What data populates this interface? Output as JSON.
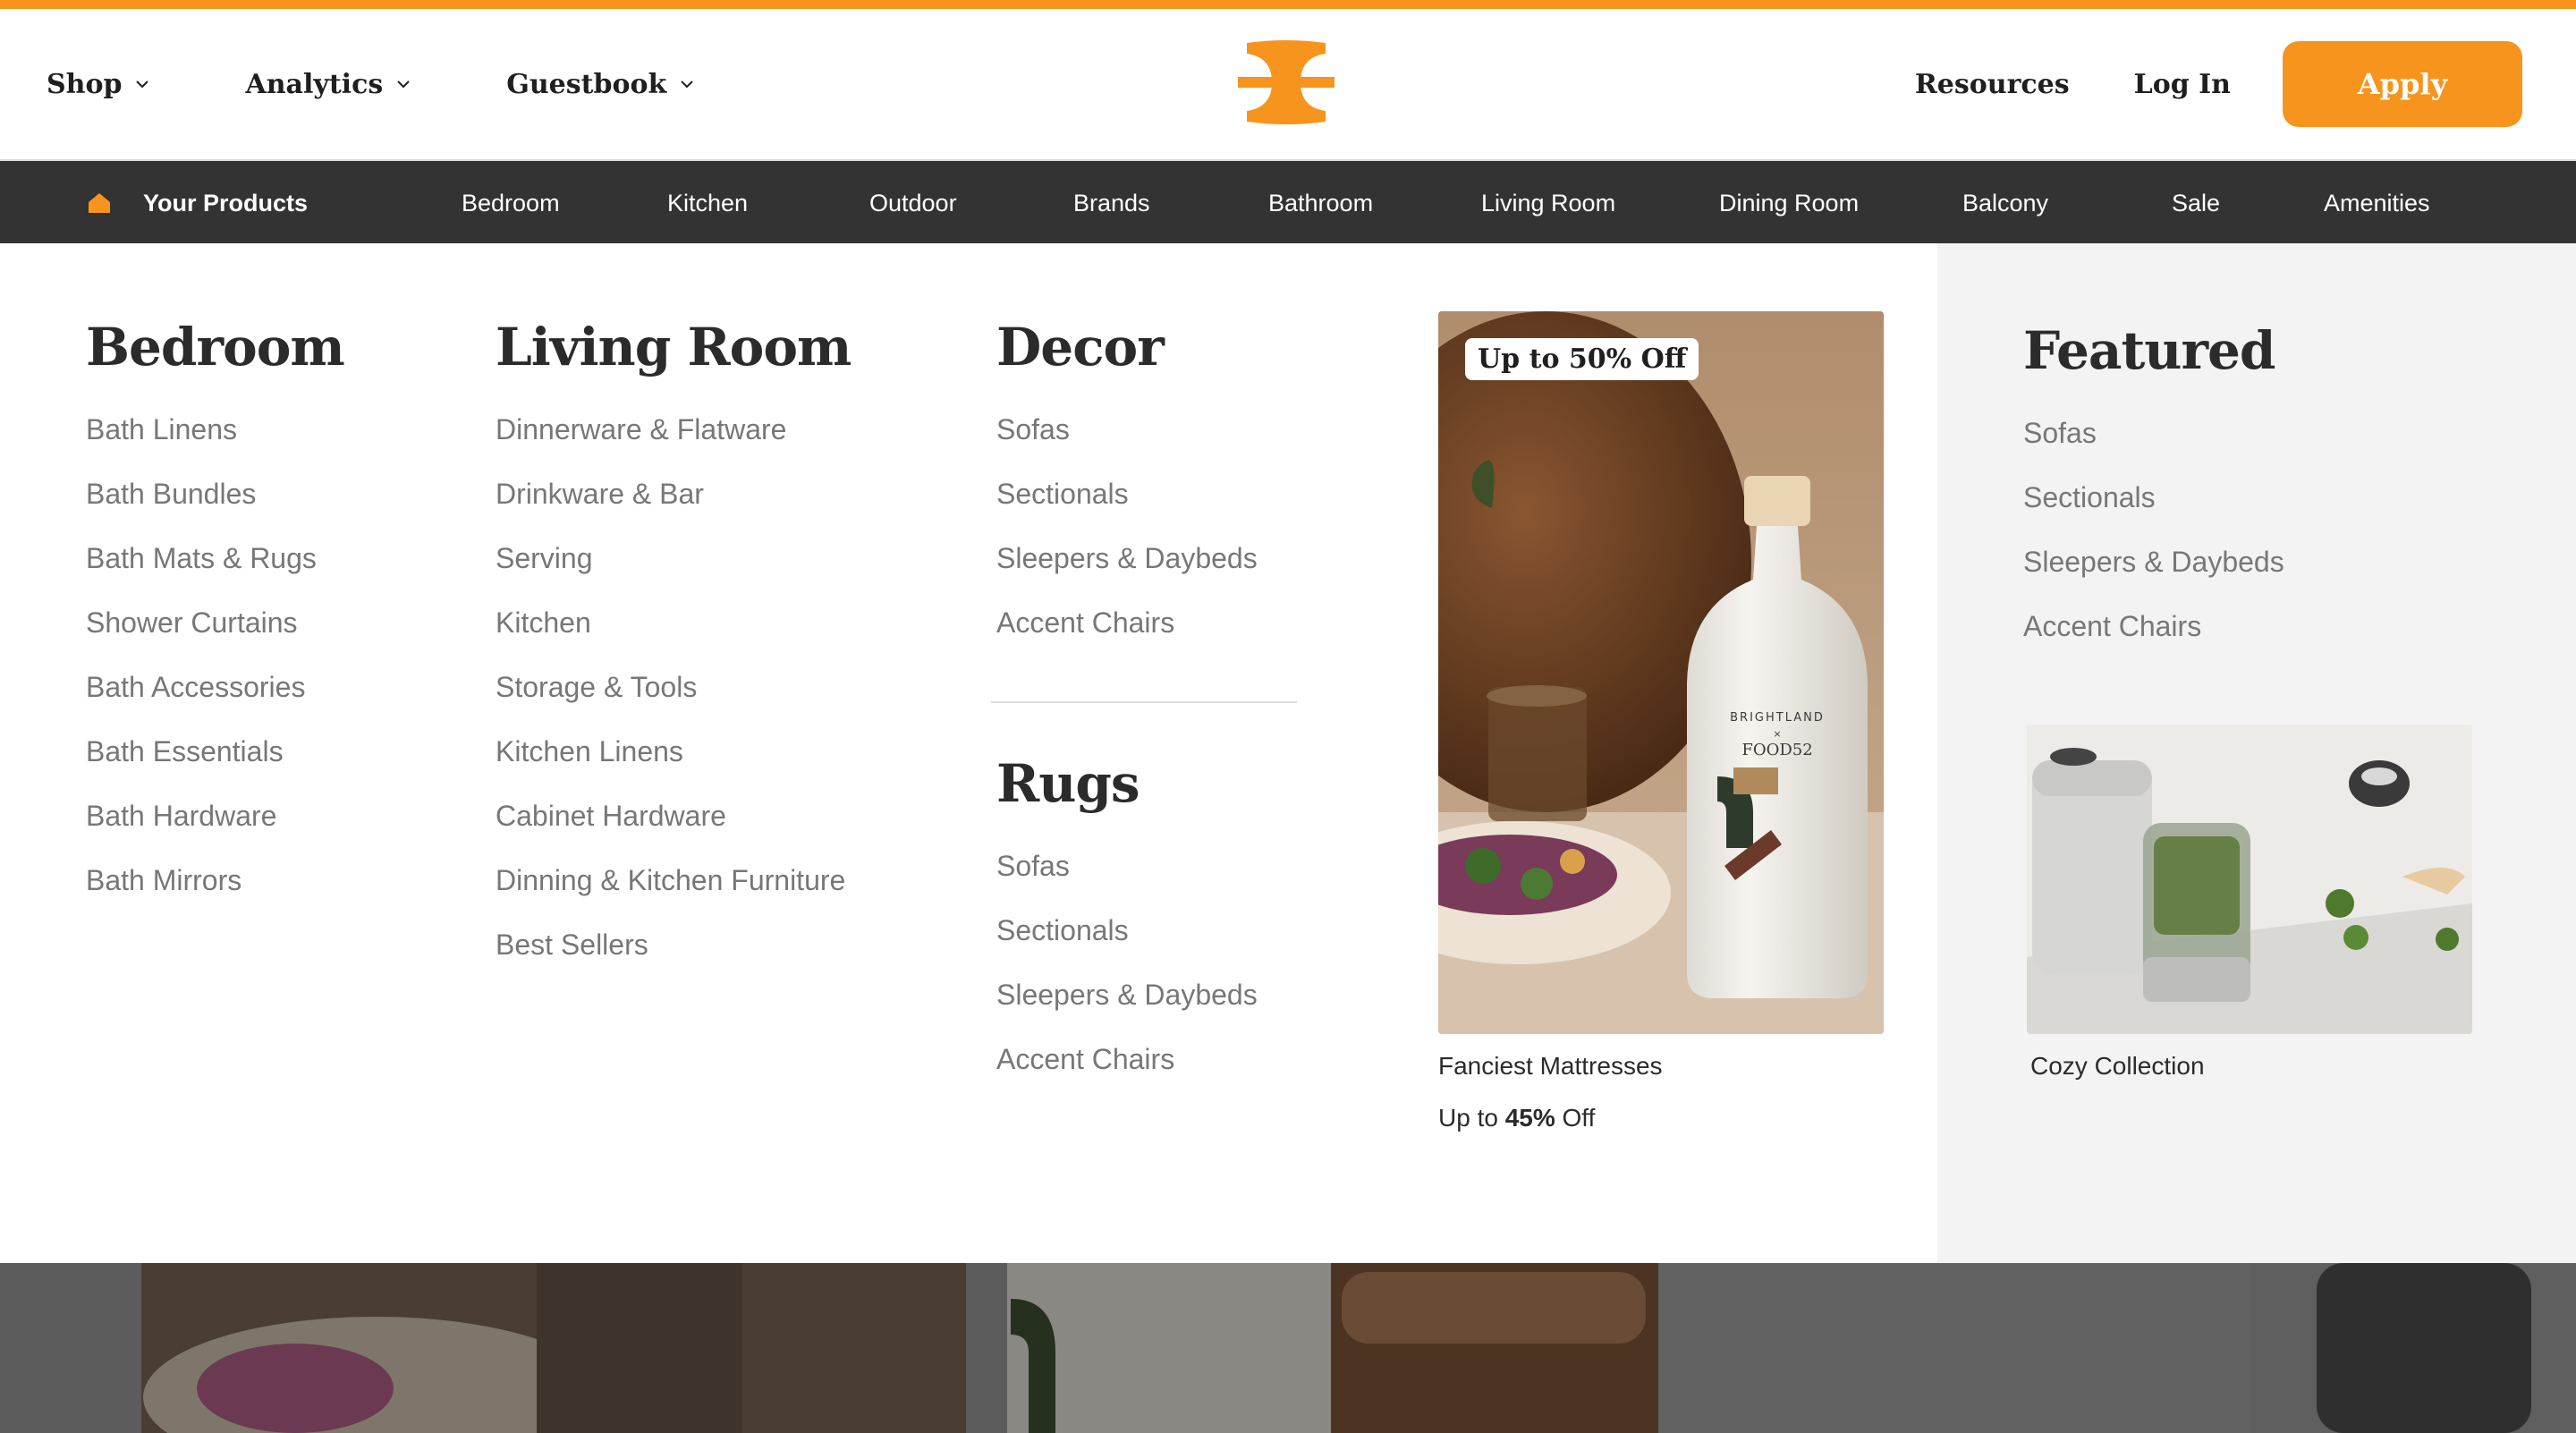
{
  "header": {
    "nav_left": [
      {
        "label": "Shop"
      },
      {
        "label": "Analytics"
      },
      {
        "label": "Guestbook"
      }
    ],
    "nav_right": {
      "resources": "Resources",
      "login": "Log In",
      "apply": "Apply"
    },
    "logo_icon": "brand-logo-icon"
  },
  "catbar": {
    "your_products": "Your Products",
    "items": [
      "Bedroom",
      "Kitchen",
      "Outdoor",
      "Brands",
      "Bathroom",
      "Living Room",
      "Dining Room",
      "Balcony",
      "Sale",
      "Amenities"
    ]
  },
  "mega": {
    "bedroom": {
      "title": "Bedroom",
      "items": [
        "Bath Linens",
        "Bath Bundles",
        "Bath Mats & Rugs",
        "Shower Curtains",
        "Bath Accessories",
        "Bath Essentials",
        "Bath Hardware",
        "Bath Mirrors"
      ]
    },
    "living_room": {
      "title": "Living Room",
      "items": [
        "Dinnerware & Flatware",
        "Drinkware & Bar",
        "Serving",
        "Kitchen",
        "Storage & Tools",
        "Kitchen Linens",
        "Cabinet Hardware",
        "Dinning & Kitchen Furniture",
        "Best Sellers"
      ]
    },
    "decor": {
      "title": "Decor",
      "items": [
        "Sofas",
        "Sectionals",
        "Sleepers & Daybeds",
        "Accent Chairs"
      ]
    },
    "rugs": {
      "title": "Rugs",
      "items": [
        "Sofas",
        "Sectionals",
        "Sleepers & Daybeds",
        "Accent Chairs"
      ]
    },
    "promo": {
      "badge": "Up to 50% Off",
      "caption": "Fanciest Mattresses",
      "sub_prefix": "Up to ",
      "sub_value": "45%",
      "sub_suffix": " Off",
      "bottle_brand": "BRIGHTLAND",
      "bottle_x": "×",
      "bottle_collab": "FOOD52"
    },
    "featured": {
      "title": "Featured",
      "items": [
        "Sofas",
        "Sectionals",
        "Sleepers & Daybeds",
        "Accent Chairs"
      ],
      "caption": "Cozy Collection"
    }
  },
  "colors": {
    "accent": "#f7941d",
    "catbar_bg": "#333333",
    "featured_bg": "#f3f3f3"
  }
}
